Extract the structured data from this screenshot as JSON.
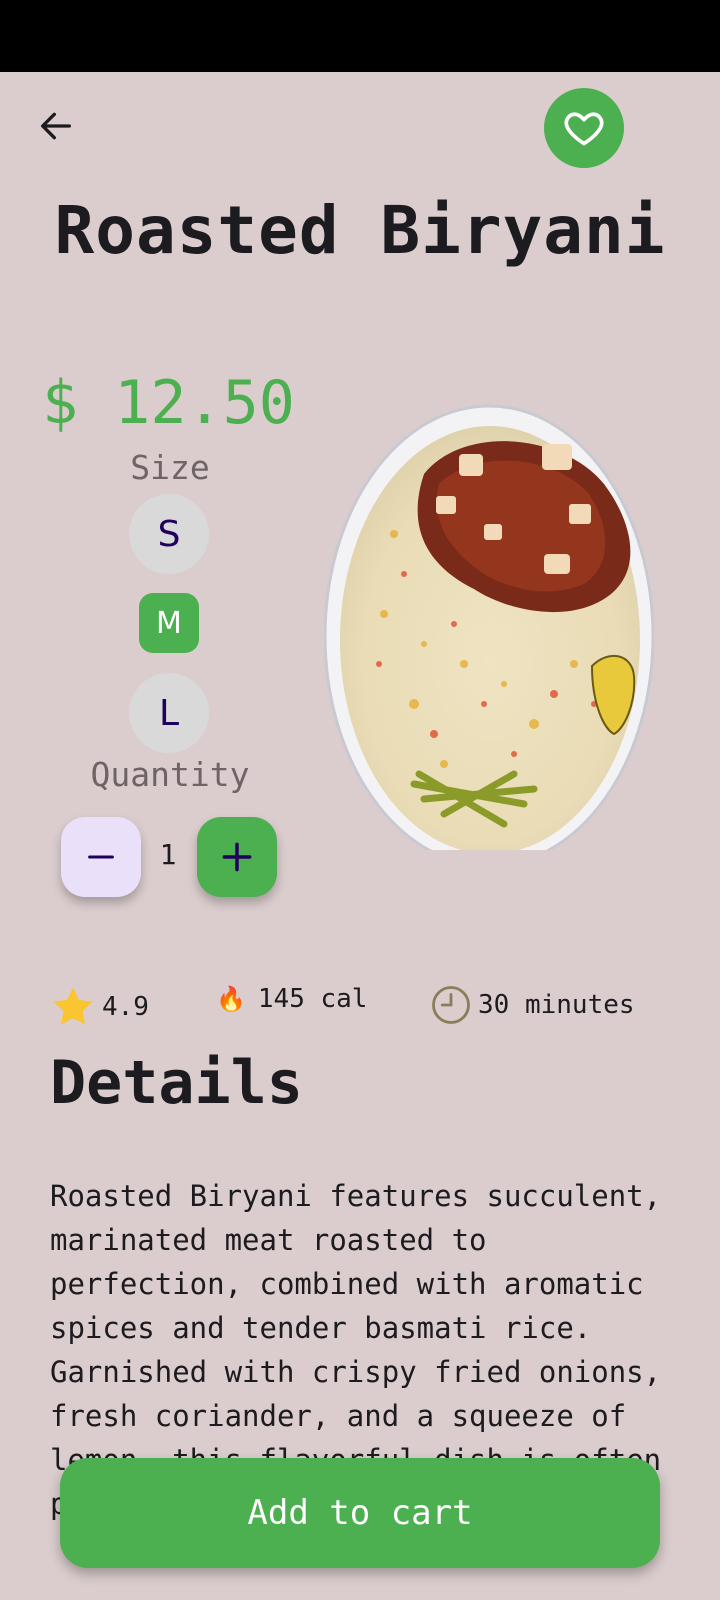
{
  "header": {
    "back_icon": "arrow-left-icon",
    "favorite_icon": "heart-outline-icon"
  },
  "product": {
    "title": "Roasted Biryani",
    "price": "$ 12.50"
  },
  "size": {
    "label": "Size",
    "options": [
      "S",
      "M",
      "L"
    ],
    "selected": "M"
  },
  "quantity": {
    "label": "Quantity",
    "value": "1",
    "minus_icon": "minus-icon",
    "plus_icon": "plus-icon"
  },
  "stats": {
    "rating": "4.9",
    "calories": "145 cal",
    "time": "30 minutes",
    "fire_glyph": "🔥"
  },
  "details": {
    "heading": "Details",
    "text": "Roasted Biryani features succulent, marinated meat roasted to perfection, combined with aromatic spices and tender basmati rice. Garnished with crispy fried onions, fresh coriander, and a squeeze of lemon, this flavorful dish is often paired with cooling raita, this"
  },
  "cart": {
    "label": "Add to cart"
  },
  "colors": {
    "background": "#dbcdcd",
    "accent": "#4caf50",
    "size_chip": "#d9d9d9",
    "minus_button": "#ebe0fa",
    "star": "#fbc531"
  }
}
